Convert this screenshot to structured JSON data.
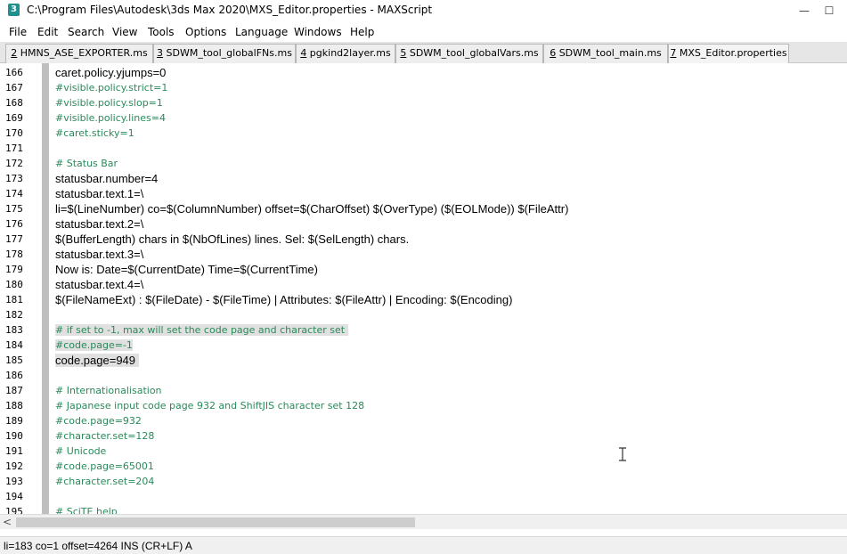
{
  "window": {
    "app_icon_text": "3",
    "title": "C:\\Program Files\\Autodesk\\3ds Max 2020\\MXS_Editor.properties - MAXScript",
    "min_glyph": "—",
    "max_glyph": "☐"
  },
  "menu": [
    {
      "label": "File"
    },
    {
      "label": "Edit"
    },
    {
      "label": "Search"
    },
    {
      "label": "View"
    },
    {
      "label": "Tools"
    },
    {
      "label": "Options"
    },
    {
      "label": "Language"
    },
    {
      "label": "Windows"
    },
    {
      "label": "Help"
    }
  ],
  "tabs": [
    {
      "num": "2",
      "label": " HMNS_ASE_EXPORTER.ms",
      "active": false
    },
    {
      "num": "3",
      "label": " SDWM_tool_globalFNs.ms",
      "active": false
    },
    {
      "num": "4",
      "label": " pgkind2layer.ms",
      "active": false
    },
    {
      "num": "5",
      "label": " SDWM_tool_globalVars.ms",
      "active": false
    },
    {
      "num": "6",
      "label": " SDWM_tool_main.ms",
      "active": false
    },
    {
      "num": "7",
      "label": " MXS_Editor.properties",
      "active": true
    }
  ],
  "lines": [
    {
      "n": "166",
      "text": "caret.policy.yjumps=0",
      "comment": false,
      "selected": false
    },
    {
      "n": "167",
      "text": "#visible.policy.strict=1",
      "comment": true,
      "selected": false
    },
    {
      "n": "168",
      "text": "#visible.policy.slop=1",
      "comment": true,
      "selected": false
    },
    {
      "n": "169",
      "text": "#visible.policy.lines=4",
      "comment": true,
      "selected": false
    },
    {
      "n": "170",
      "text": "#caret.sticky=1",
      "comment": true,
      "selected": false
    },
    {
      "n": "171",
      "text": "",
      "comment": false,
      "selected": false
    },
    {
      "n": "172",
      "text": "# Status Bar",
      "comment": true,
      "selected": false
    },
    {
      "n": "173",
      "text": "statusbar.number=4",
      "comment": false,
      "selected": false
    },
    {
      "n": "174",
      "text": "statusbar.text.1=\\",
      "comment": false,
      "selected": false
    },
    {
      "n": "175",
      "text": "li=$(LineNumber) co=$(ColumnNumber) offset=$(CharOffset) $(OverType) ($(EOLMode)) $(FileAttr)",
      "comment": false,
      "selected": false
    },
    {
      "n": "176",
      "text": "statusbar.text.2=\\",
      "comment": false,
      "selected": false
    },
    {
      "n": "177",
      "text": "$(BufferLength) chars in $(NbOfLines) lines. Sel: $(SelLength) chars.",
      "comment": false,
      "selected": false
    },
    {
      "n": "178",
      "text": "statusbar.text.3=\\",
      "comment": false,
      "selected": false
    },
    {
      "n": "179",
      "text": "Now is: Date=$(CurrentDate) Time=$(CurrentTime)",
      "comment": false,
      "selected": false
    },
    {
      "n": "180",
      "text": "statusbar.text.4=\\",
      "comment": false,
      "selected": false
    },
    {
      "n": "181",
      "text": "$(FileNameExt) : $(FileDate) - $(FileTime) | Attributes: $(FileAttr) | Encoding: $(Encoding)",
      "comment": false,
      "selected": false
    },
    {
      "n": "182",
      "text": "",
      "comment": false,
      "selected": false
    },
    {
      "n": "183",
      "text": "# if set to -1, max will set the code page and character set ",
      "comment": true,
      "selected": true
    },
    {
      "n": "184",
      "text": "#code.page=-1",
      "comment": true,
      "selected": true
    },
    {
      "n": "185",
      "text": "code.page=949 ",
      "comment": false,
      "selected": true
    },
    {
      "n": "186",
      "text": "",
      "comment": false,
      "selected": false
    },
    {
      "n": "187",
      "text": "# Internationalisation",
      "comment": true,
      "selected": false
    },
    {
      "n": "188",
      "text": "# Japanese input code page 932 and ShiftJIS character set 128",
      "comment": true,
      "selected": false
    },
    {
      "n": "189",
      "text": "#code.page=932",
      "comment": true,
      "selected": false
    },
    {
      "n": "190",
      "text": "#character.set=128",
      "comment": true,
      "selected": false
    },
    {
      "n": "191",
      "text": "# Unicode",
      "comment": true,
      "selected": false
    },
    {
      "n": "192",
      "text": "#code.page=65001",
      "comment": true,
      "selected": false
    },
    {
      "n": "193",
      "text": "#character.set=204",
      "comment": true,
      "selected": false
    },
    {
      "n": "194",
      "text": "",
      "comment": false,
      "selected": false
    },
    {
      "n": "195",
      "text": "# SciTE help",
      "comment": true,
      "selected": false
    }
  ],
  "scrollbar": {
    "left_arrow": "<"
  },
  "status": {
    "text": "li=183 co=1 offset=4264 INS (CR+LF) A"
  },
  "colors": {
    "comment": "#2a8a5a",
    "selection": "#e0e0e0",
    "fold_margin": "#bfbfbf"
  }
}
